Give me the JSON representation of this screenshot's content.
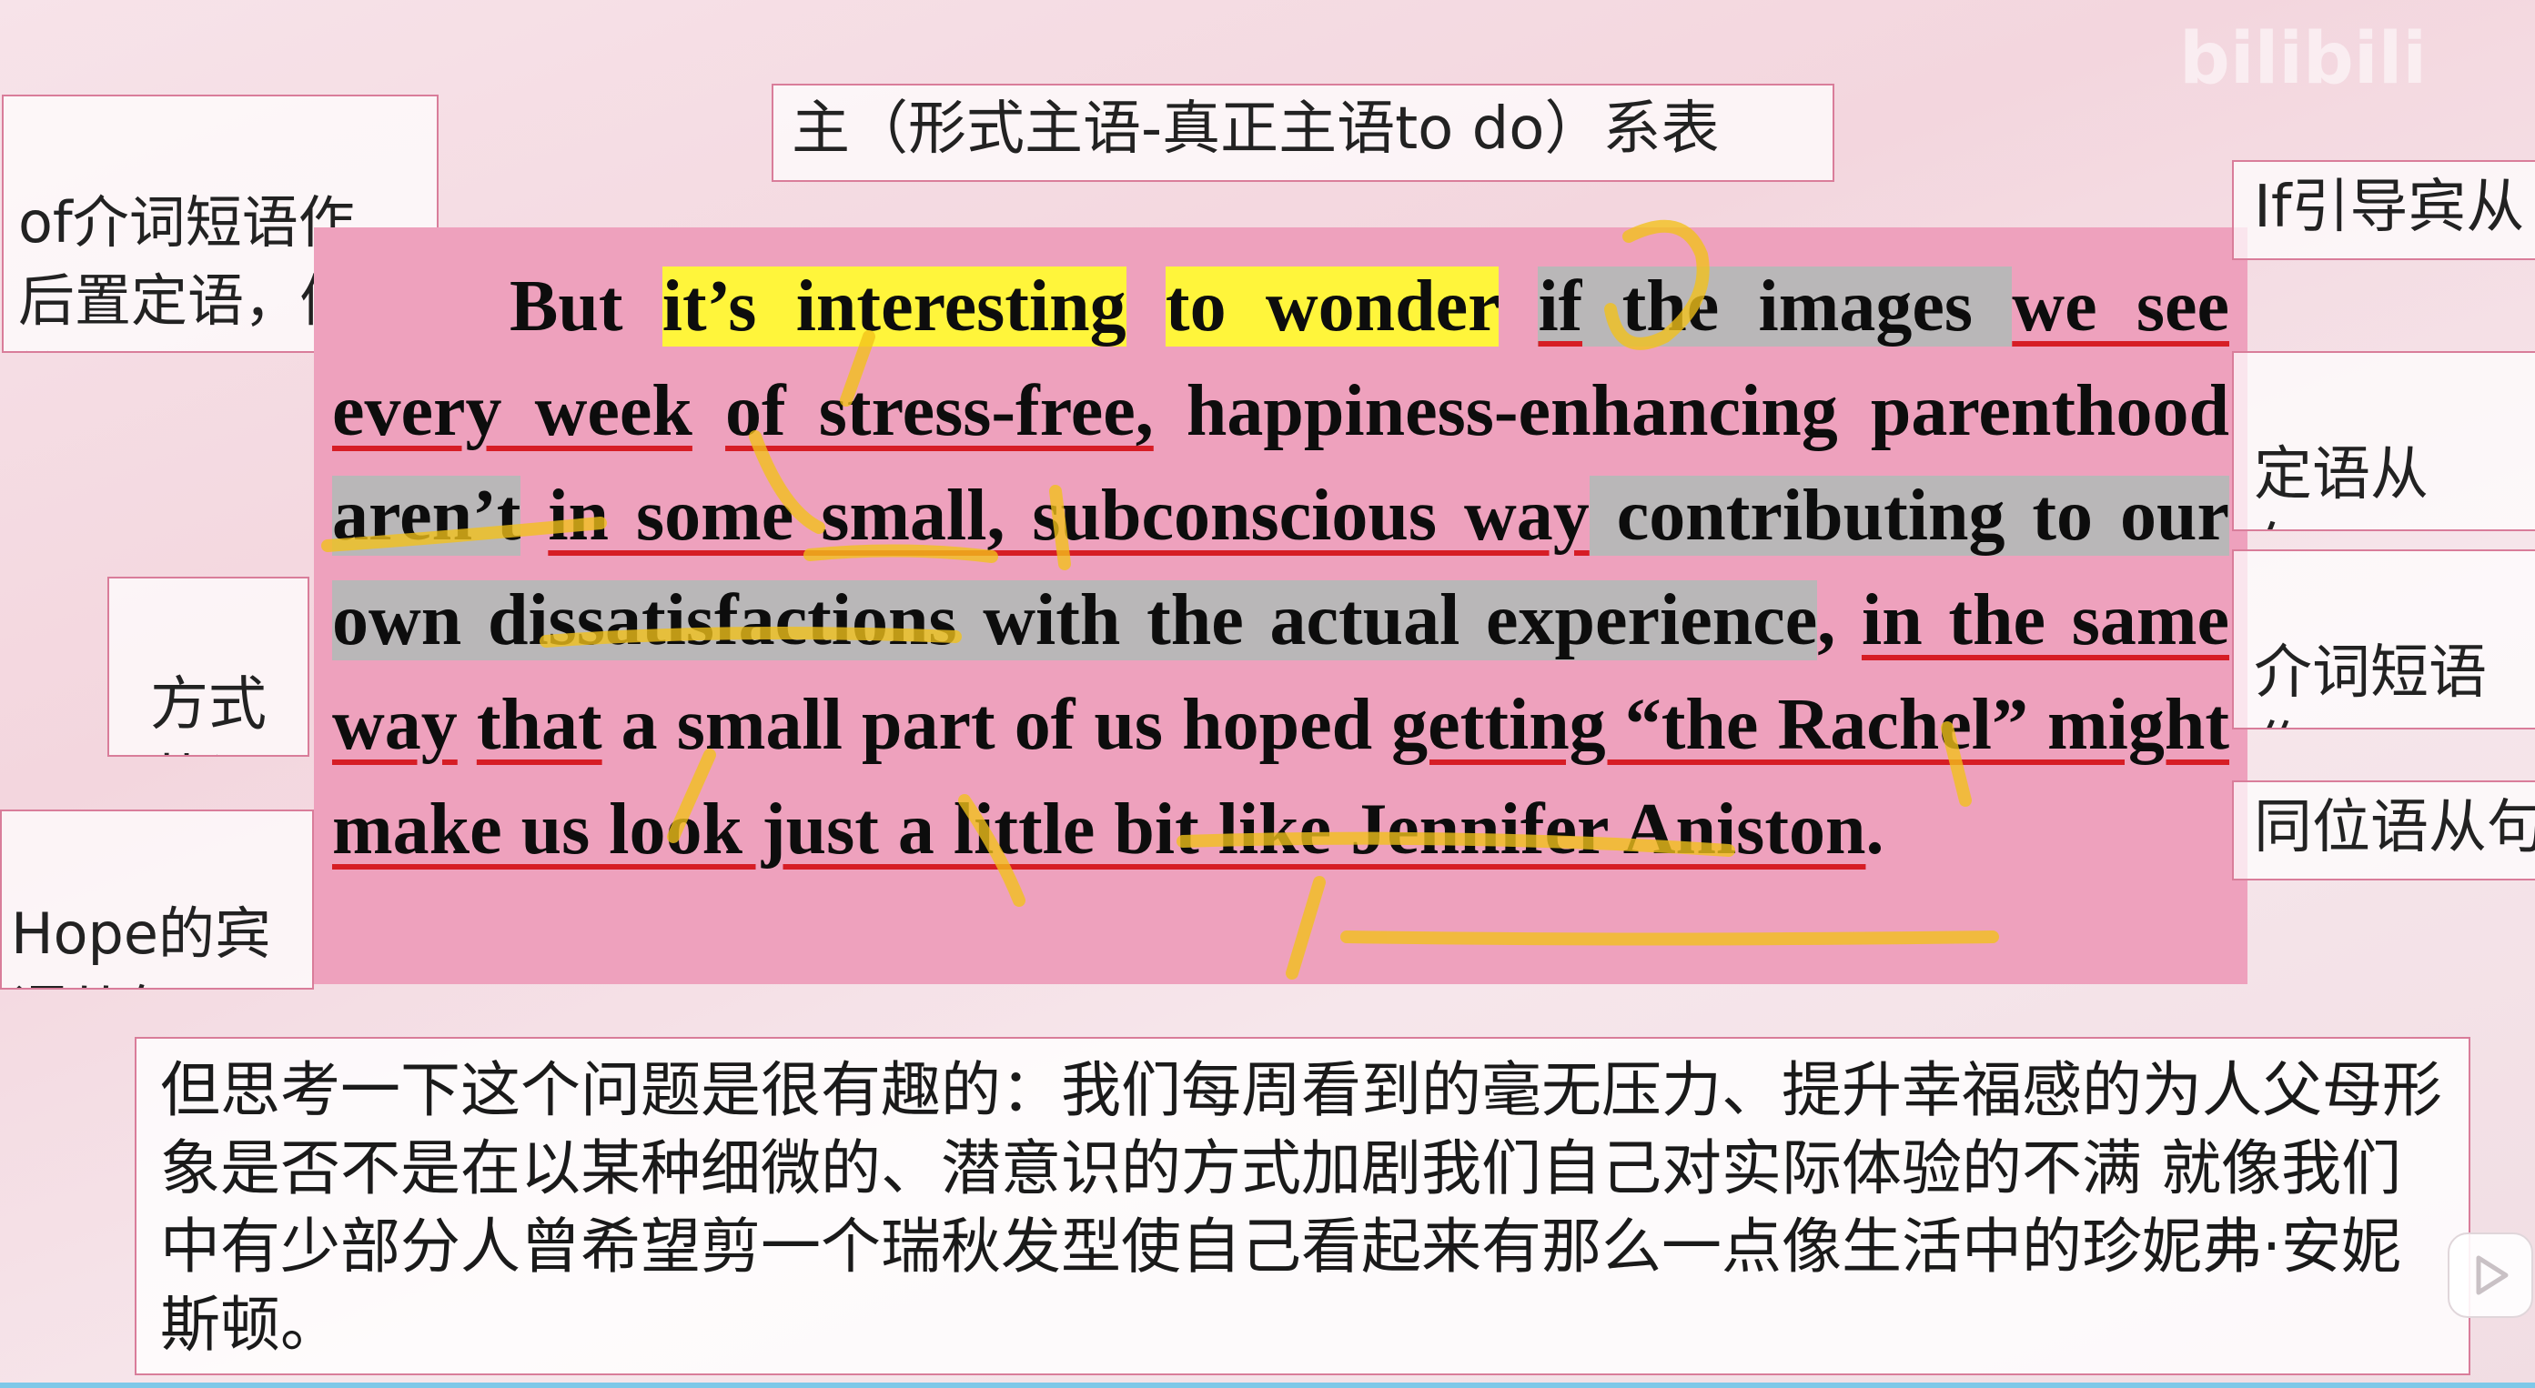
{
  "watermark": "bilibili",
  "annotations": {
    "top_title": "主（形式主语-真正主语to do）系表",
    "left_of_phrase": "of介词短语作\n后置定语，修\n饰images",
    "left_manner": "方式\n状语",
    "left_hope": "Hope的宾\n语从句",
    "right_if": "If引导宾从",
    "right_attr": "定语从句，\n省略了that",
    "right_prep": "介词短语作\n方式状语",
    "right_appos": "同位语从句"
  },
  "sentence": {
    "s1": "But ",
    "s2": "it’s interesting",
    "s3": " ",
    "s4": "to wonder",
    "s5": " ",
    "s6": "if",
    "s7": " the images ",
    "s8": "we see every week",
    "s9": " ",
    "s10": "of stress-free,",
    "s11": " happiness-enhancing parenthood ",
    "s12": "aren’t",
    "s13": " ",
    "s14": "in some small, subconscious way",
    "s15": " contributing to our own dissatisfactions with the actual experience",
    "s16": ", ",
    "s17": "in the same way",
    "s18": " ",
    "s19": "that",
    "s20": " a small part of us hoped ",
    "s21": "getting “the Rachel” might make us look just a little bit like Jennifer Aniston",
    "s22": "."
  },
  "translation": "但思考一下这个问题是很有趣的：我们每周看到的毫无压力、提升幸福感的为人父母形象是否不是在以某种细微的、潜意识的方式加剧我们自己对实际体验的不满 就像我们中有少部分人曾希望剪一个瑞秋发型使自己看起来有那么一点像生活中的珍妮弗·安妮斯顿。",
  "colors": {
    "main_bg": "#eea1bd",
    "highlight_yellow": "#fff53b",
    "highlight_gray": "#b9b7b8",
    "underline_red": "#d61d25",
    "pen_yellow": "#f2c21a"
  },
  "icons": [
    "play-icon"
  ]
}
